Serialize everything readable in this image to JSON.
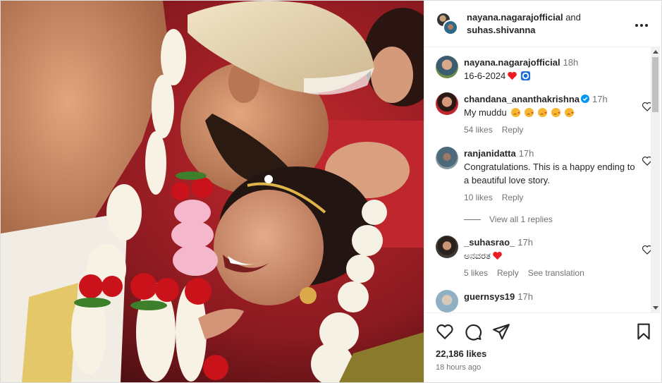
{
  "header": {
    "user1": "nayana.nagarajofficial",
    "conjunction": "and",
    "user2": "suhas.shivanna",
    "more_icon": "more-horizontal-icon"
  },
  "caption": {
    "username": "nayana.nagarajofficial",
    "time": "18h",
    "text": "16-6-2024"
  },
  "comments": [
    {
      "username": "chandana_ananthakrishna",
      "verified": true,
      "time": "17h",
      "text": "My muddu",
      "likes": "54 likes",
      "reply": "Reply"
    },
    {
      "username": "ranjanidatta",
      "time": "17h",
      "text": "Congratulations. This is a happy ending to a beautiful love story.",
      "likes": "10 likes",
      "reply": "Reply",
      "view_replies": "View all 1 replies"
    },
    {
      "username": "_suhasrao_",
      "time": "17h",
      "text": "ಅನವರತ",
      "likes": "5 likes",
      "reply": "Reply",
      "translation": "See translation"
    },
    {
      "username": "guernsys19",
      "time": "17h"
    }
  ],
  "actions": {
    "likes": "22,186 likes",
    "posted": "18 hours ago"
  },
  "colors": {
    "text": "#262626",
    "muted": "#737373",
    "heart_red": "#ed1c24",
    "verified_blue": "#0095f6"
  }
}
